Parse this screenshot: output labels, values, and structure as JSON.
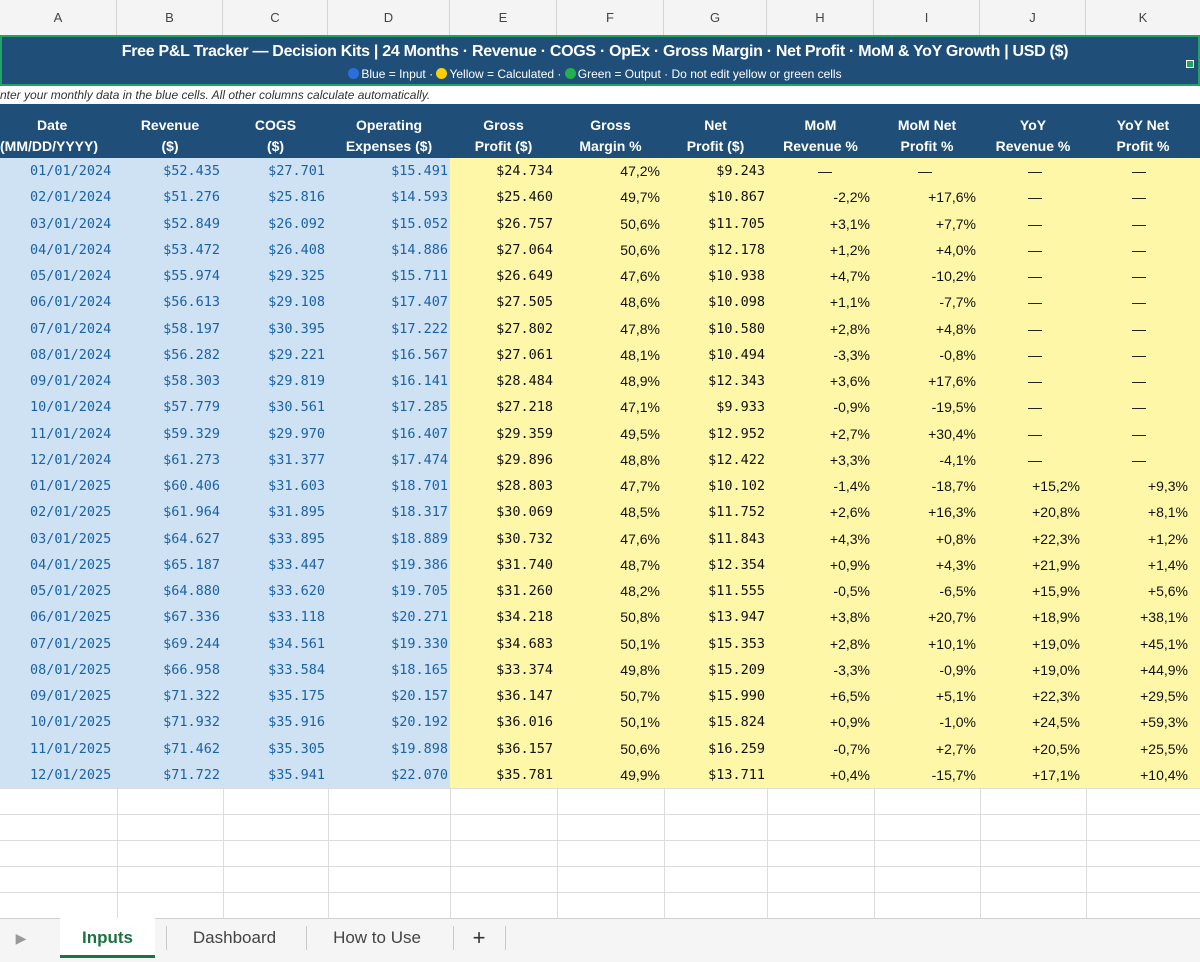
{
  "column_letters": [
    "A",
    "B",
    "C",
    "D",
    "E",
    "F",
    "G",
    "H",
    "I",
    "J",
    "K"
  ],
  "banner": {
    "title": "Free P&L Tracker — Decision Kits  |  24 Months  ·  Revenue · COGS · OpEx · Gross Margin · Net Profit · MoM & YoY Growth  |  USD ($)",
    "legend_blue": "Blue = Input",
    "legend_yellow": "Yellow = Calculated",
    "legend_green": "Green = Output",
    "legend_note": "Do not edit yellow or green cells",
    "sep": "·"
  },
  "instructions": "Enter your monthly data in the blue cells. All other columns calculate automatically.",
  "headers": [
    [
      "Date",
      "(MM/DD/YYYY)"
    ],
    [
      "Revenue",
      "($)"
    ],
    [
      "COGS",
      "($)"
    ],
    [
      "Operating",
      "Expenses ($)"
    ],
    [
      "Gross",
      "Profit ($)"
    ],
    [
      "Gross",
      "Margin %"
    ],
    [
      "Net",
      "Profit ($)"
    ],
    [
      "MoM",
      "Revenue %"
    ],
    [
      "MoM Net",
      "Profit %"
    ],
    [
      "YoY",
      "Revenue %"
    ],
    [
      "YoY Net",
      "Profit %"
    ]
  ],
  "rows": [
    [
      "01/01/2024",
      "$52.435",
      "$27.701",
      "$15.491",
      "$24.734",
      "47,2%",
      "$9.243",
      "—",
      "—",
      "—",
      "—"
    ],
    [
      "02/01/2024",
      "$51.276",
      "$25.816",
      "$14.593",
      "$25.460",
      "49,7%",
      "$10.867",
      "-2,2%",
      "+17,6%",
      "—",
      "—"
    ],
    [
      "03/01/2024",
      "$52.849",
      "$26.092",
      "$15.052",
      "$26.757",
      "50,6%",
      "$11.705",
      "+3,1%",
      "+7,7%",
      "—",
      "—"
    ],
    [
      "04/01/2024",
      "$53.472",
      "$26.408",
      "$14.886",
      "$27.064",
      "50,6%",
      "$12.178",
      "+1,2%",
      "+4,0%",
      "—",
      "—"
    ],
    [
      "05/01/2024",
      "$55.974",
      "$29.325",
      "$15.711",
      "$26.649",
      "47,6%",
      "$10.938",
      "+4,7%",
      "-10,2%",
      "—",
      "—"
    ],
    [
      "06/01/2024",
      "$56.613",
      "$29.108",
      "$17.407",
      "$27.505",
      "48,6%",
      "$10.098",
      "+1,1%",
      "-7,7%",
      "—",
      "—"
    ],
    [
      "07/01/2024",
      "$58.197",
      "$30.395",
      "$17.222",
      "$27.802",
      "47,8%",
      "$10.580",
      "+2,8%",
      "+4,8%",
      "—",
      "—"
    ],
    [
      "08/01/2024",
      "$56.282",
      "$29.221",
      "$16.567",
      "$27.061",
      "48,1%",
      "$10.494",
      "-3,3%",
      "-0,8%",
      "—",
      "—"
    ],
    [
      "09/01/2024",
      "$58.303",
      "$29.819",
      "$16.141",
      "$28.484",
      "48,9%",
      "$12.343",
      "+3,6%",
      "+17,6%",
      "—",
      "—"
    ],
    [
      "10/01/2024",
      "$57.779",
      "$30.561",
      "$17.285",
      "$27.218",
      "47,1%",
      "$9.933",
      "-0,9%",
      "-19,5%",
      "—",
      "—"
    ],
    [
      "11/01/2024",
      "$59.329",
      "$29.970",
      "$16.407",
      "$29.359",
      "49,5%",
      "$12.952",
      "+2,7%",
      "+30,4%",
      "—",
      "—"
    ],
    [
      "12/01/2024",
      "$61.273",
      "$31.377",
      "$17.474",
      "$29.896",
      "48,8%",
      "$12.422",
      "+3,3%",
      "-4,1%",
      "—",
      "—"
    ],
    [
      "01/01/2025",
      "$60.406",
      "$31.603",
      "$18.701",
      "$28.803",
      "47,7%",
      "$10.102",
      "-1,4%",
      "-18,7%",
      "+15,2%",
      "+9,3%"
    ],
    [
      "02/01/2025",
      "$61.964",
      "$31.895",
      "$18.317",
      "$30.069",
      "48,5%",
      "$11.752",
      "+2,6%",
      "+16,3%",
      "+20,8%",
      "+8,1%"
    ],
    [
      "03/01/2025",
      "$64.627",
      "$33.895",
      "$18.889",
      "$30.732",
      "47,6%",
      "$11.843",
      "+4,3%",
      "+0,8%",
      "+22,3%",
      "+1,2%"
    ],
    [
      "04/01/2025",
      "$65.187",
      "$33.447",
      "$19.386",
      "$31.740",
      "48,7%",
      "$12.354",
      "+0,9%",
      "+4,3%",
      "+21,9%",
      "+1,4%"
    ],
    [
      "05/01/2025",
      "$64.880",
      "$33.620",
      "$19.705",
      "$31.260",
      "48,2%",
      "$11.555",
      "-0,5%",
      "-6,5%",
      "+15,9%",
      "+5,6%"
    ],
    [
      "06/01/2025",
      "$67.336",
      "$33.118",
      "$20.271",
      "$34.218",
      "50,8%",
      "$13.947",
      "+3,8%",
      "+20,7%",
      "+18,9%",
      "+38,1%"
    ],
    [
      "07/01/2025",
      "$69.244",
      "$34.561",
      "$19.330",
      "$34.683",
      "50,1%",
      "$15.353",
      "+2,8%",
      "+10,1%",
      "+19,0%",
      "+45,1%"
    ],
    [
      "08/01/2025",
      "$66.958",
      "$33.584",
      "$18.165",
      "$33.374",
      "49,8%",
      "$15.209",
      "-3,3%",
      "-0,9%",
      "+19,0%",
      "+44,9%"
    ],
    [
      "09/01/2025",
      "$71.322",
      "$35.175",
      "$20.157",
      "$36.147",
      "50,7%",
      "$15.990",
      "+6,5%",
      "+5,1%",
      "+22,3%",
      "+29,5%"
    ],
    [
      "10/01/2025",
      "$71.932",
      "$35.916",
      "$20.192",
      "$36.016",
      "50,1%",
      "$15.824",
      "+0,9%",
      "-1,0%",
      "+24,5%",
      "+59,3%"
    ],
    [
      "11/01/2025",
      "$71.462",
      "$35.305",
      "$19.898",
      "$36.157",
      "50,6%",
      "$16.259",
      "-0,7%",
      "+2,7%",
      "+20,5%",
      "+25,5%"
    ],
    [
      "12/01/2025",
      "$71.722",
      "$35.941",
      "$22.070",
      "$35.781",
      "49,9%",
      "$13.711",
      "+0,4%",
      "-15,7%",
      "+17,1%",
      "+10,4%"
    ]
  ],
  "sheet_tabs": {
    "tab1": "Inputs",
    "tab2": "Dashboard",
    "tab3": "How to Use",
    "add": "+",
    "nav": "▶",
    "active": "Inputs"
  },
  "colors": {
    "banner": "#1f4e79",
    "input_fill": "#cfe2f3",
    "calc_fill": "#fff7a8",
    "input_text": "#1a62a8",
    "active_tab": "#1e7145",
    "legend_blue_dot": "#2a6fdb",
    "legend_yellow_dot": "#ffd000",
    "legend_green_dot": "#22b14c"
  }
}
